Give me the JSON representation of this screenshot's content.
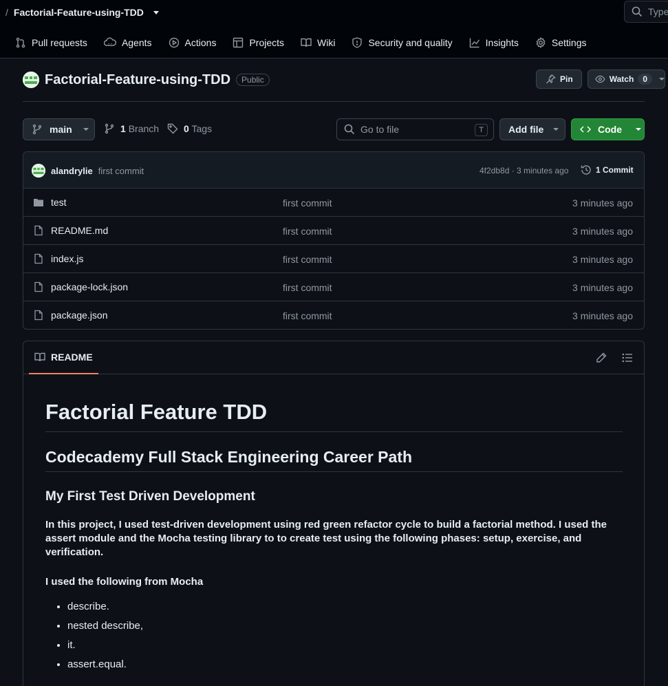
{
  "breadcrumb": {
    "separator": "/",
    "repo": "Factorial-Feature-using-TDD"
  },
  "search": {
    "placeholder": "Type"
  },
  "nav": [
    {
      "label": "Pull requests",
      "icon": "pull-request-icon"
    },
    {
      "label": "Agents",
      "icon": "agents-icon"
    },
    {
      "label": "Actions",
      "icon": "play-icon"
    },
    {
      "label": "Projects",
      "icon": "table-icon"
    },
    {
      "label": "Wiki",
      "icon": "book-icon"
    },
    {
      "label": "Security and quality",
      "icon": "shield-icon"
    },
    {
      "label": "Insights",
      "icon": "graph-icon"
    },
    {
      "label": "Settings",
      "icon": "gear-icon"
    }
  ],
  "repo": {
    "title": "Factorial-Feature-using-TDD",
    "visibility": "Public",
    "pin_label": "Pin",
    "watch_label": "Watch",
    "watch_count": "0"
  },
  "toolbar": {
    "branch": "main",
    "branch_count": "1",
    "branch_label": "Branch",
    "tag_count": "0",
    "tag_label": "Tags",
    "goto_placeholder": "Go to file",
    "goto_shortcut": "T",
    "add_file": "Add file",
    "code": "Code"
  },
  "latest_commit": {
    "author": "alandrylie",
    "message": "first commit",
    "sha_time": "4f2db8d · 3 minutes ago",
    "commits": "1 Commit"
  },
  "files": [
    {
      "name": "test",
      "type": "folder",
      "message": "first commit",
      "age": "3 minutes ago"
    },
    {
      "name": "README.md",
      "type": "file",
      "message": "first commit",
      "age": "3 minutes ago"
    },
    {
      "name": "index.js",
      "type": "file",
      "message": "first commit",
      "age": "3 minutes ago"
    },
    {
      "name": "package-lock.json",
      "type": "file",
      "message": "first commit",
      "age": "3 minutes ago"
    },
    {
      "name": "package.json",
      "type": "file",
      "message": "first commit",
      "age": "3 minutes ago"
    }
  ],
  "readme": {
    "tab": "README",
    "h1": "Factorial Feature TDD",
    "h2": "Codecademy Full Stack Engineering Career Path",
    "h3": "My First Test Driven Development",
    "lead": "In this project, I used test-driven development using red green refactor cycle to build a factorial method. I used the assert module and the Mocha testing library to to create test using the following phases: setup, exercise, and verification.",
    "sub": "I used the following from Mocha",
    "items": [
      "describe.",
      "nested describe,",
      "it.",
      "assert.equal."
    ]
  },
  "colors": {
    "accent_green": "#238636",
    "tab_underline": "#f78166",
    "bg": "#0d1117"
  }
}
